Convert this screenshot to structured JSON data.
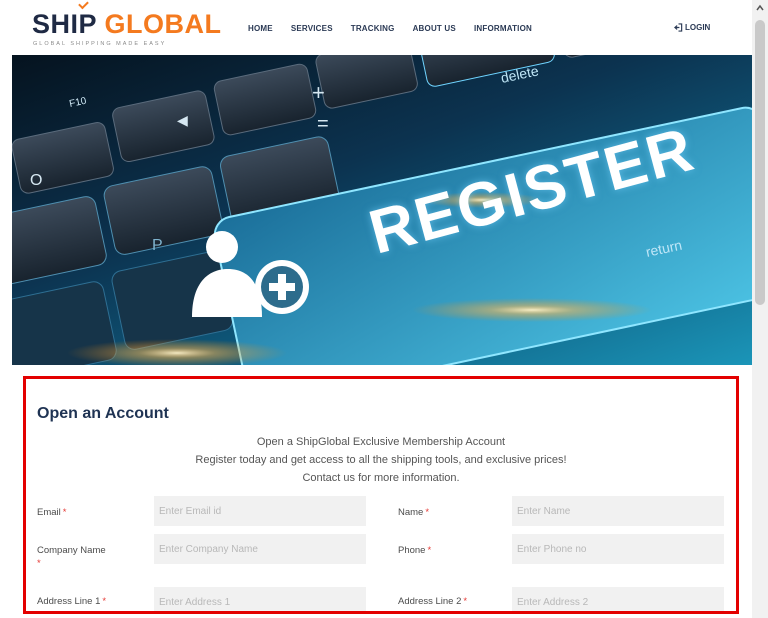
{
  "header": {
    "logo_primary_a": "SHIP",
    "logo_primary_b": "GLOBAL",
    "logo_tagline": "GLOBAL SHIPPING MADE EASY",
    "nav": [
      "HOME",
      "SERVICES",
      "TRACKING",
      "ABOUT US",
      "INFORMATION"
    ],
    "login_label": "LOGIN",
    "login_icon": "login-arrow-icon"
  },
  "hero": {
    "keyboard_keys": [
      "F10",
      "delete",
      "return",
      "P",
      "O"
    ],
    "register_label": "REGISTER",
    "register_icon": "add-user-icon"
  },
  "form": {
    "title": "Open an Account",
    "intro_lines": [
      "Open a ShipGlobal Exclusive Membership Account",
      "Register today and get access to all the shipping tools, and exclusive prices!",
      "Contact us for more information."
    ],
    "required_marker": "*",
    "fields": [
      {
        "label": "Email",
        "placeholder": "Enter Email id",
        "value": ""
      },
      {
        "label": "Name",
        "placeholder": "Enter Name",
        "value": ""
      },
      {
        "label": "Company Name",
        "placeholder": "Enter Company Name",
        "value": ""
      },
      {
        "label": "Phone",
        "placeholder": "Enter Phone no",
        "value": ""
      },
      {
        "label": "Address Line 1",
        "placeholder": "Enter Address 1",
        "value": ""
      },
      {
        "label": "Address Line 2",
        "placeholder": "Enter Address 2",
        "value": ""
      }
    ]
  },
  "colors": {
    "brand_dark": "#1f2a44",
    "brand_orange": "#f47a1f",
    "highlight_border": "#e30000",
    "required": "#e53935"
  }
}
